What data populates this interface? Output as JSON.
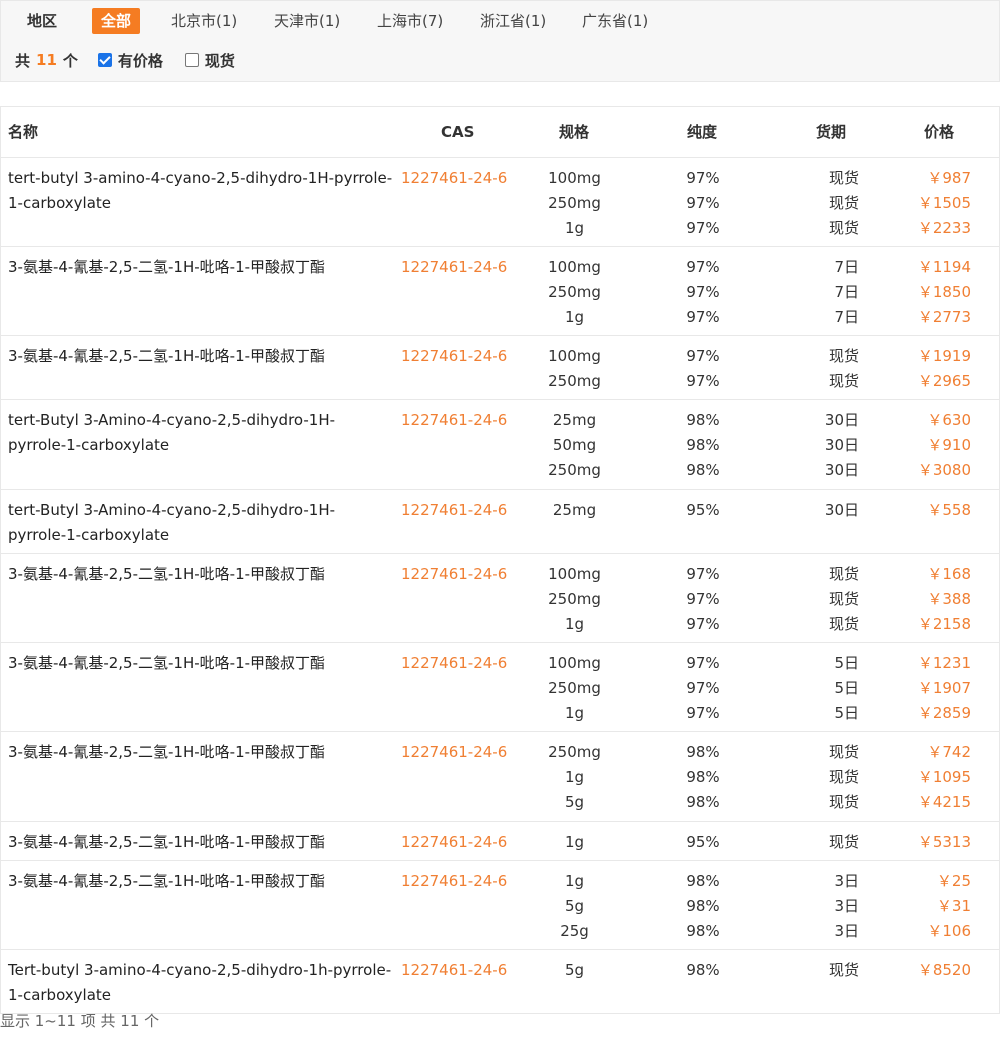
{
  "filters": {
    "region_label": "地区",
    "chips": [
      "全部",
      "北京市(1)",
      "天津市(1)",
      "上海市(7)",
      "浙江省(1)",
      "广东省(1)"
    ],
    "total_prefix": "共",
    "total_count": "11",
    "total_suffix": "个",
    "has_price_label": "有价格",
    "has_price_checked": true,
    "in_stock_label": "现货",
    "in_stock_checked": false
  },
  "table": {
    "headers": {
      "name": "名称",
      "cas": "CAS",
      "spec": "规格",
      "purity": "纯度",
      "delivery": "货期",
      "price": "价格"
    },
    "rows": [
      {
        "name": "tert-butyl 3-amino-4-cyano-2,5-dihydro-1H-pyrrole-1-carboxylate",
        "cas": "1227461-24-6",
        "items": [
          {
            "spec": "100mg",
            "purity": "97%",
            "delivery": "现货",
            "price": "￥987"
          },
          {
            "spec": "250mg",
            "purity": "97%",
            "delivery": "现货",
            "price": "￥1505"
          },
          {
            "spec": "1g",
            "purity": "97%",
            "delivery": "现货",
            "price": "￥2233"
          }
        ]
      },
      {
        "name": "3-氨基-4-氰基-2,5-二氢-1H-吡咯-1-甲酸叔丁酯",
        "cas": "1227461-24-6",
        "items": [
          {
            "spec": "100mg",
            "purity": "97%",
            "delivery": "7日",
            "price": "￥1194"
          },
          {
            "spec": "250mg",
            "purity": "97%",
            "delivery": "7日",
            "price": "￥1850"
          },
          {
            "spec": "1g",
            "purity": "97%",
            "delivery": "7日",
            "price": "￥2773"
          }
        ]
      },
      {
        "name": "3-氨基-4-氰基-2,5-二氢-1H-吡咯-1-甲酸叔丁酯",
        "cas": "1227461-24-6",
        "items": [
          {
            "spec": "100mg",
            "purity": "97%",
            "delivery": "现货",
            "price": "￥1919"
          },
          {
            "spec": "250mg",
            "purity": "97%",
            "delivery": "现货",
            "price": "￥2965"
          }
        ]
      },
      {
        "name": "tert-Butyl 3-Amino-4-cyano-2,5-dihydro-1H-pyrrole-1-carboxylate",
        "cas": "1227461-24-6",
        "items": [
          {
            "spec": "25mg",
            "purity": "98%",
            "delivery": "30日",
            "price": "￥630"
          },
          {
            "spec": "50mg",
            "purity": "98%",
            "delivery": "30日",
            "price": "￥910"
          },
          {
            "spec": "250mg",
            "purity": "98%",
            "delivery": "30日",
            "price": "￥3080"
          }
        ]
      },
      {
        "name": "tert-Butyl 3-Amino-4-cyano-2,5-dihydro-1H-pyrrole-1-carboxylate",
        "cas": "1227461-24-6",
        "items": [
          {
            "spec": "25mg",
            "purity": "95%",
            "delivery": "30日",
            "price": "￥558"
          }
        ]
      },
      {
        "name": "3-氨基-4-氰基-2,5-二氢-1H-吡咯-1-甲酸叔丁酯",
        "cas": "1227461-24-6",
        "items": [
          {
            "spec": "100mg",
            "purity": "97%",
            "delivery": "现货",
            "price": "￥168"
          },
          {
            "spec": "250mg",
            "purity": "97%",
            "delivery": "现货",
            "price": "￥388"
          },
          {
            "spec": "1g",
            "purity": "97%",
            "delivery": "现货",
            "price": "￥2158"
          }
        ]
      },
      {
        "name": "3-氨基-4-氰基-2,5-二氢-1H-吡咯-1-甲酸叔丁酯",
        "cas": "1227461-24-6",
        "items": [
          {
            "spec": "100mg",
            "purity": "97%",
            "delivery": "5日",
            "price": "￥1231"
          },
          {
            "spec": "250mg",
            "purity": "97%",
            "delivery": "5日",
            "price": "￥1907"
          },
          {
            "spec": "1g",
            "purity": "97%",
            "delivery": "5日",
            "price": "￥2859"
          }
        ]
      },
      {
        "name": "3-氨基-4-氰基-2,5-二氢-1H-吡咯-1-甲酸叔丁酯",
        "cas": "1227461-24-6",
        "items": [
          {
            "spec": "250mg",
            "purity": "98%",
            "delivery": "现货",
            "price": "￥742"
          },
          {
            "spec": "1g",
            "purity": "98%",
            "delivery": "现货",
            "price": "￥1095"
          },
          {
            "spec": "5g",
            "purity": "98%",
            "delivery": "现货",
            "price": "￥4215"
          }
        ]
      },
      {
        "name": "3-氨基-4-氰基-2,5-二氢-1H-吡咯-1-甲酸叔丁酯",
        "cas": "1227461-24-6",
        "items": [
          {
            "spec": "1g",
            "purity": "95%",
            "delivery": "现货",
            "price": "￥5313"
          }
        ]
      },
      {
        "name": "3-氨基-4-氰基-2,5-二氢-1H-吡咯-1-甲酸叔丁酯",
        "cas": "1227461-24-6",
        "items": [
          {
            "spec": "1g",
            "purity": "98%",
            "delivery": "3日",
            "price": "￥25"
          },
          {
            "spec": "5g",
            "purity": "98%",
            "delivery": "3日",
            "price": "￥31"
          },
          {
            "spec": "25g",
            "purity": "98%",
            "delivery": "3日",
            "price": "￥106"
          }
        ]
      },
      {
        "name": "Tert-butyl 3-amino-4-cyano-2,5-dihydro-1h-pyrrole-1-carboxylate",
        "cas": "1227461-24-6",
        "items": [
          {
            "spec": "5g",
            "purity": "98%",
            "delivery": "现货",
            "price": "￥8520"
          }
        ]
      }
    ]
  },
  "footer": {
    "summary": "显示 1~11 项 共 11 个"
  },
  "colors": {
    "accent": "#f57c22",
    "price": "#f07f33",
    "checkbox": "#1a73e8"
  }
}
